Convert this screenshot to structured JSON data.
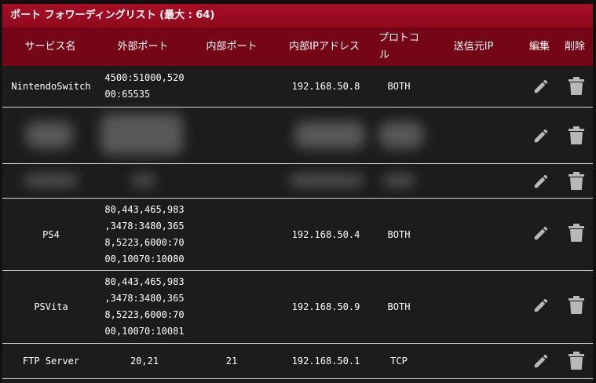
{
  "title": "ポート フォワーディングリスト (最大 : 64)",
  "columns": {
    "service": "サービス名",
    "external_port": "外部ポート",
    "internal_port": "内部ポート",
    "internal_ip": "内部IPアドレス",
    "protocol_line1": "プロトコ",
    "protocol_line2": "ル",
    "source_ip": "送信元IP",
    "edit": "編集",
    "delete": "削除"
  },
  "rows": [
    {
      "service": "NintendoSwitch",
      "external_port_lines": [
        "4500:51000,520",
        "00:65535"
      ],
      "internal_port": "",
      "internal_ip": "192.168.50.8",
      "protocol": "BOTH",
      "source_ip": ""
    },
    {
      "redacted": true
    },
    {
      "redacted": true
    },
    {
      "service": "PS4",
      "external_port_lines": [
        "80,443,465,983",
        ",3478:3480,365",
        "8,5223,6000:70",
        "00,10070:10080"
      ],
      "internal_port": "",
      "internal_ip": "192.168.50.4",
      "protocol": "BOTH",
      "source_ip": ""
    },
    {
      "service": "PSVita",
      "external_port_lines": [
        "80,443,465,983",
        ",3478:3480,365",
        "8,5223,6000:70",
        "00,10070:10081"
      ],
      "internal_port": "",
      "internal_ip": "192.168.50.9",
      "protocol": "BOTH",
      "source_ip": ""
    },
    {
      "service": "FTP Server",
      "external_port_lines": [
        "20,21"
      ],
      "internal_port": "21",
      "internal_ip": "192.168.50.1",
      "protocol": "TCP",
      "source_ip": ""
    }
  ],
  "icons": {
    "edit": "pencil-icon",
    "delete": "trash-icon"
  },
  "colors": {
    "title_bar": "#9b0b21",
    "header_row": "#740617",
    "background": "#1c1c1c",
    "icon": "#b8b8b8"
  }
}
